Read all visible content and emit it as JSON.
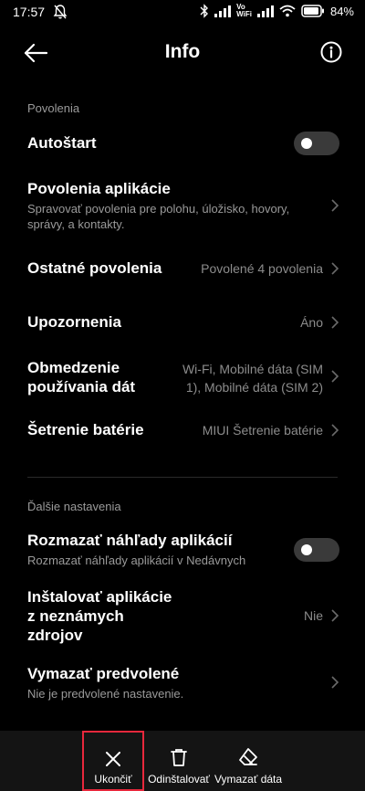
{
  "status_bar": {
    "time": "17:57",
    "battery_percent": "84%",
    "volte_top": "Vo",
    "volte_bottom": "WiFi"
  },
  "header": {
    "title": "Info"
  },
  "sections": [
    {
      "label": "Povolenia",
      "rows": [
        {
          "title": "Autoštart",
          "toggle": false
        },
        {
          "title": "Povolenia aplikácie",
          "subtitle": "Spravovať povolenia pre polohu, úložisko, hovory, správy, a kontakty."
        },
        {
          "title": "Ostatné povolenia",
          "value": "Povolené 4 povolenia"
        },
        {
          "title": "Upozornenia",
          "value": "Áno"
        },
        {
          "title_line1": "Obmedzenie",
          "title_line2": "používania dát",
          "value_line1": "Wi-Fi, Mobilné dáta (SIM",
          "value_line2": "1), Mobilné dáta (SIM 2)"
        },
        {
          "title": "Šetrenie batérie",
          "value": "MIUI Šetrenie batérie"
        }
      ]
    },
    {
      "label": "Ďalšie nastavenia",
      "rows": [
        {
          "title": "Rozmazať náhľady aplikácií",
          "subtitle": "Rozmazať náhľady aplikácií v Nedávnych",
          "toggle": false
        },
        {
          "title_line1": "Inštalovať aplikácie",
          "title_line2": "z neznámych",
          "title_line3": "zdrojov",
          "value": "Nie"
        },
        {
          "title": "Vymazať predvolené",
          "subtitle": "Nie je predvolené nastavenie."
        }
      ]
    }
  ],
  "bottom_bar": {
    "actions": [
      {
        "label": "Ukončiť",
        "icon": "close-icon",
        "highlighted": true
      },
      {
        "label": "Odinštalovať",
        "icon": "trash-icon"
      },
      {
        "label": "Vymazať dáta",
        "icon": "eraser-icon"
      }
    ]
  },
  "colors": {
    "background": "#000000",
    "secondary_text": "#9a9a9a",
    "toggle_off": "#3a3a3a",
    "bottom_bar": "#141414",
    "highlight_border": "#e8283c"
  }
}
